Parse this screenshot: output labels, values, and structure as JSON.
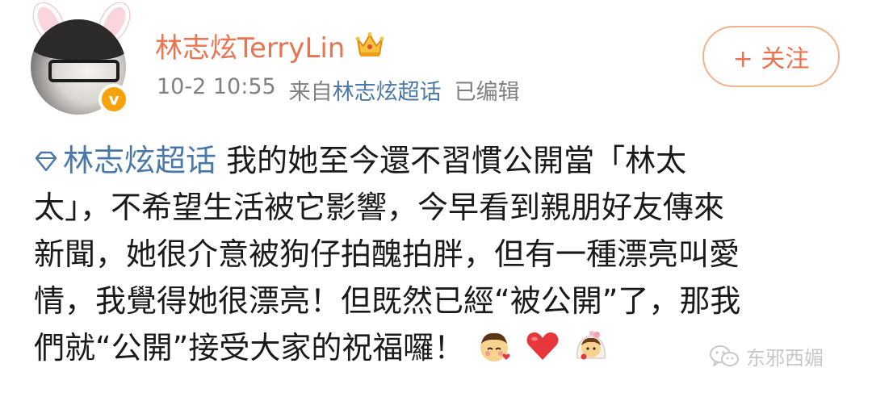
{
  "post": {
    "username": "林志炫TerryLin",
    "timestamp": "10-2 10:55",
    "source_prefix": "来自",
    "source_name": "林志炫超话",
    "edited_label": "已编辑",
    "follow_label": "+ 关注",
    "content": {
      "topic": "林志炫超话",
      "line1": " 我的她至今還不習慣公開當「林太",
      "line2": "太」，不希望生活被它影響，今早看到親朋好友傳來",
      "line3": "新聞，她很介意被狗仔拍醜拍胖，但有一種漂亮叫愛",
      "line4": "情，我覺得她很漂亮！但既然已經“被公開”了，那我",
      "line5": "們就“公開”接受大家的祝福囉！"
    },
    "emojis": [
      "shy-face-emoji",
      "heart-emoji",
      "bride-emoji"
    ]
  },
  "watermark": {
    "text": "东邪西媚"
  },
  "colors": {
    "username": "#eb7350",
    "link": "#4a78a8",
    "meta": "#808080",
    "verified_badge": "#f9a10b",
    "follow_border": "#f3b190",
    "text": "#1a1a1a"
  },
  "icons": {
    "verified": "verified-v-icon",
    "member": "crown-icon",
    "topic": "diamond-icon",
    "watermark": "wechat-icon"
  }
}
